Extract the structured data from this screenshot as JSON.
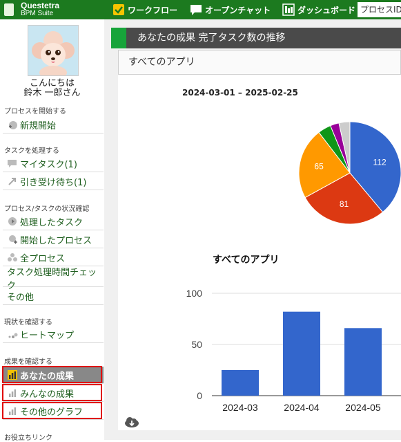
{
  "app": {
    "name": "Questetra",
    "subtitle": "BPM Suite"
  },
  "topnav": {
    "workflow": "ワークフロー",
    "chat": "オープンチャット",
    "dashboard": "ダッシュボード",
    "process_id": "プロセスID"
  },
  "user": {
    "greeting": "こんにちは",
    "name": "鈴木 一郎さん"
  },
  "sidebar": {
    "start_section": "プロセスを開始する",
    "new_start": "新規開始",
    "task_section": "タスクを処理する",
    "my_task": "マイタスク(1)",
    "pending": "引き受け待ち(1)",
    "status_section": "プロセス/タスクの状況確認",
    "handled_tasks": "処理したタスク",
    "started_processes": "開始したプロセス",
    "all_processes": "全プロセス",
    "time_check": "タスク処理時間チェック",
    "other": "その他",
    "current_section": "現状を確認する",
    "heatmap": "ヒートマップ",
    "results_section": "成果を確認する",
    "my_results": "あなたの成果",
    "everyone_results": "みんなの成果",
    "other_graphs": "その他のグラフ",
    "links_section": "お役立ちリンク"
  },
  "main": {
    "panel_title": "あなたの成果 完了タスク数の推移",
    "app_selector": "すべてのアプリ"
  },
  "colors": {
    "brand": "#1c7a1f",
    "accent_green": "#17a43a",
    "highlight": "#e00000",
    "bar": "#3366cc"
  },
  "chart_data": [
    {
      "type": "pie",
      "title": "2024-03-01 – 2025-02-25",
      "slices": [
        {
          "label": "",
          "value": 112,
          "color": "#3366cc"
        },
        {
          "label": "",
          "value": 81,
          "color": "#dc3912"
        },
        {
          "label": "",
          "value": 65,
          "color": "#ff9900"
        },
        {
          "label": "",
          "value": 12,
          "color": "#109618"
        },
        {
          "label": "",
          "value": 8,
          "color": "#990099"
        },
        {
          "label": "",
          "value": 10,
          "color": "#cccccc"
        }
      ]
    },
    {
      "type": "bar",
      "title": "すべてのアプリ",
      "categories": [
        "2024-03",
        "2024-04",
        "2024-05"
      ],
      "values": [
        25,
        82,
        66
      ],
      "ylim": [
        0,
        100
      ],
      "yticks": [
        0,
        50,
        100
      ],
      "grid": true
    }
  ]
}
